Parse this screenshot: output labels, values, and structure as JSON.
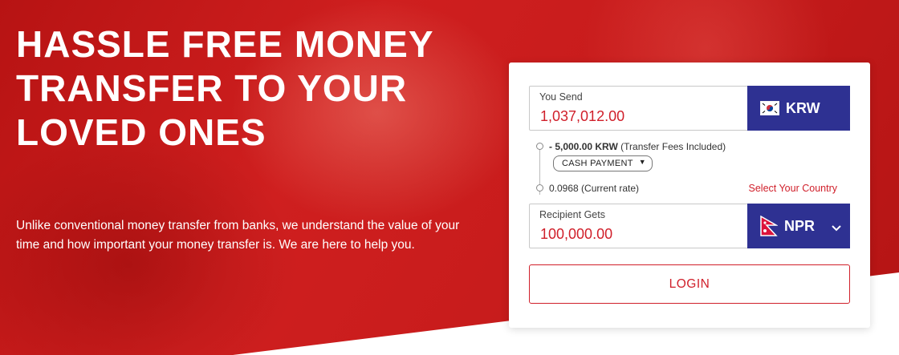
{
  "hero": {
    "headline": "HASSLE FREE MONEY TRANSFER TO YOUR LOVED ONES",
    "subtext": "Unlike conventional money transfer from banks, we understand the value of your time and how important your money transfer is. We are here to help you."
  },
  "form": {
    "send": {
      "label": "You Send",
      "value": "1,037,012.00",
      "currency": "KRW",
      "flag_icon": "south-korea-flag-icon"
    },
    "fee": {
      "amount": "- 5,000.00 KRW",
      "note": "(Transfer Fees Included)"
    },
    "payment_method": {
      "selected": "CASH PAYMENT"
    },
    "rate": {
      "text": "0.0968 (Current rate)"
    },
    "select_country_link": "Select Your Country",
    "receive": {
      "label": "Recipient Gets",
      "value": "100,000.00",
      "currency": "NPR",
      "flag_icon": "nepal-flag-icon"
    },
    "login_label": "LOGIN"
  },
  "colors": {
    "brand_red": "#d01f2a",
    "currency_blue": "#2e3192"
  }
}
